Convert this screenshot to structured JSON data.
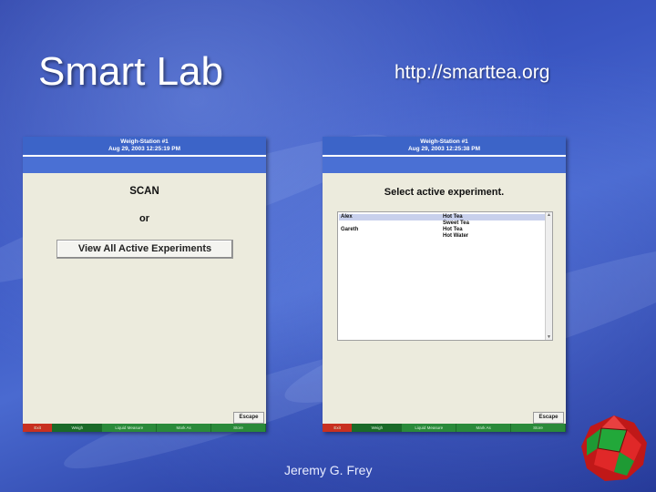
{
  "slide": {
    "title": "Smart Lab",
    "url": "http://smarttea.org",
    "author": "Jeremy G. Frey"
  },
  "left_screen": {
    "header_line1": "Weigh-Station #1",
    "header_line2": "Aug 29, 2003 12:25:19 PM",
    "scan_label": "SCAN",
    "or_label": "or",
    "view_button": "View All Active Experiments",
    "escape_button": "Escape",
    "footer_tabs": [
      "Exit",
      "Weigh",
      "Liquid Measure",
      "Mark As",
      "Store"
    ]
  },
  "right_screen": {
    "header_line1": "Weigh-Station #1",
    "header_line2": "Aug 29, 2003 12:25:38 PM",
    "prompt": "Select active experiment.",
    "list_rows": [
      {
        "user": "Alex",
        "experiment": "Hot Tea"
      },
      {
        "user": "",
        "experiment": "Sweet Tea"
      },
      {
        "user": "Gareth",
        "experiment": "Hot Tea"
      },
      {
        "user": "",
        "experiment": "Hot Water"
      }
    ],
    "scroll_up": "▲",
    "scroll_down": "▼",
    "escape_button": "Escape",
    "footer_tabs": [
      "Exit",
      "Weigh",
      "Liquid Measure",
      "Mark As",
      "Store"
    ]
  },
  "colors": {
    "header_blue": "#3c64c8",
    "footer_green": "#2a8a3a",
    "exit_red": "#c83020",
    "selected_row": "#c8d0ec"
  },
  "icons": [
    "polyhedron-logo-icon"
  ]
}
